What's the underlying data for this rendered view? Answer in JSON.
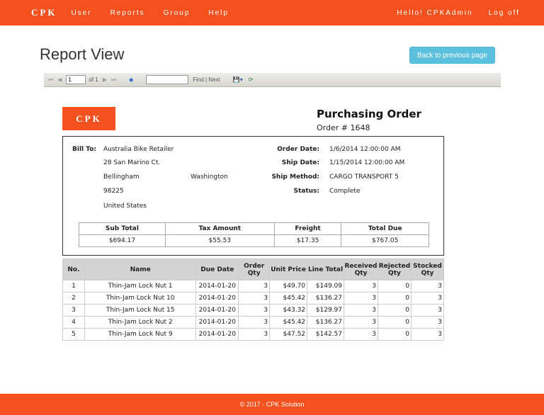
{
  "nav": {
    "brand": "CPK",
    "links": [
      "User",
      "Reports",
      "Group",
      "Help"
    ],
    "greeting": "Hello! CPKAdmin",
    "logoff": "Log off"
  },
  "page": {
    "title": "Report View",
    "back_label": "Back to previous page"
  },
  "toolbar": {
    "page_value": "1",
    "of_text": "of 1",
    "find_label": "Find | Next"
  },
  "report": {
    "logo": "CPK",
    "title": "Purchasing Order",
    "order_no": "Order # 1648",
    "bill_to_label": "Bill To:",
    "bill_to": {
      "name": "Australia Bike Retailer",
      "street": "28 San Marino Ct.",
      "city": "Bellingham",
      "state": "Washington",
      "zip": "98225",
      "country": "United States"
    },
    "meta": [
      {
        "label": "Order Date:",
        "value": "1/6/2014 12:00:00 AM"
      },
      {
        "label": "Ship Date:",
        "value": "1/15/2014 12:00:00 AM"
      },
      {
        "label": "Ship Method:",
        "value": "CARGO TRANSPORT 5"
      },
      {
        "label": "Status:",
        "value": "Complete"
      }
    ],
    "totals": {
      "headers": [
        "Sub Total",
        "Tax Amount",
        "Freight",
        "Total Due"
      ],
      "values": [
        "$694.17",
        "$55.53",
        "$17.35",
        "$767.05"
      ]
    },
    "items": {
      "headers": [
        "No.",
        "Name",
        "Due Date",
        "Order Qty",
        "Unit Price",
        "Line Total",
        "Received Qty",
        "Rejected Qty",
        "Stocked Qty"
      ],
      "rows": [
        [
          "1",
          "Thin-Jam Lock Nut 1",
          "2014-01-20",
          "3",
          "$49.70",
          "$149.09",
          "3",
          "0",
          "3"
        ],
        [
          "2",
          "Thin-Jam Lock Nut 10",
          "2014-01-20",
          "3",
          "$45.42",
          "$136.27",
          "3",
          "0",
          "3"
        ],
        [
          "3",
          "Thin-Jam Lock Nut 15",
          "2014-01-20",
          "3",
          "$43.32",
          "$129.97",
          "3",
          "0",
          "3"
        ],
        [
          "4",
          "Thin-Jam Lock Nut 2",
          "2014-01-20",
          "3",
          "$45.42",
          "$136.27",
          "3",
          "0",
          "3"
        ],
        [
          "5",
          "Thin-Jam Lock Nut 9",
          "2014-01-20",
          "3",
          "$47.52",
          "$142.57",
          "3",
          "0",
          "3"
        ]
      ]
    }
  },
  "footer": "© 2017 - CPK Solution"
}
